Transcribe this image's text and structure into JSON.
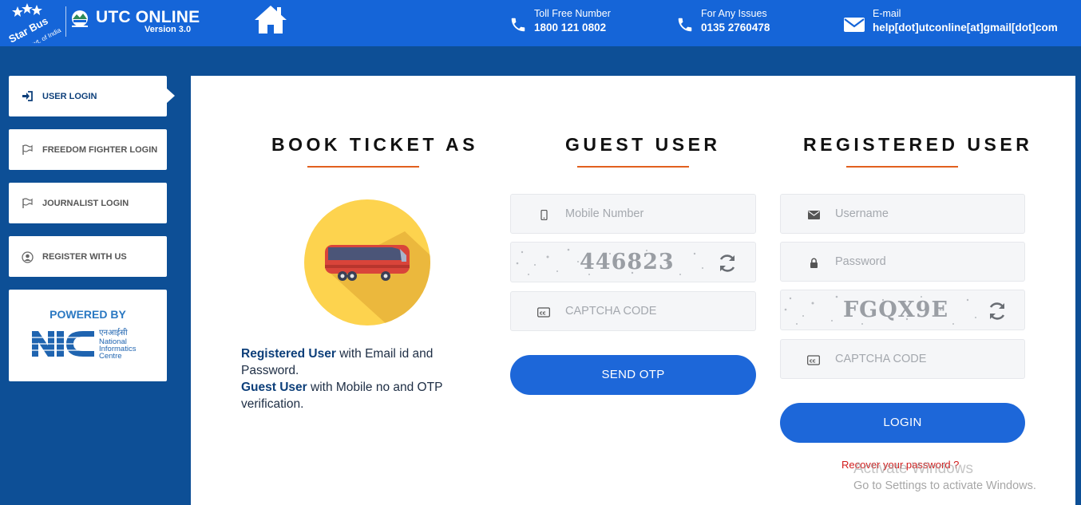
{
  "header": {
    "logo_text": "Star Bus",
    "logo_subtext": "Govt. of India",
    "app_title": "UTC ONLINE",
    "app_version": "Version 3.0",
    "home_icon": "home-icon",
    "contacts": [
      {
        "label": "Toll Free Number",
        "value": "1800 121 0802",
        "icon": "phone-icon"
      },
      {
        "label": "For Any Issues",
        "value": "0135 2760478",
        "icon": "phone-icon"
      },
      {
        "label": "E-mail",
        "value": "help[dot]utconline[at]gmail[dot]com",
        "icon": "envelope-icon"
      }
    ]
  },
  "sidebar": {
    "items": [
      {
        "label": "USER LOGIN",
        "icon": "sign-in-icon",
        "active": true
      },
      {
        "label": "FREEDOM FIGHTER LOGIN",
        "icon": "flag-icon"
      },
      {
        "label": "JOURNALIST LOGIN",
        "icon": "flag-icon"
      },
      {
        "label": "REGISTER WITH US",
        "icon": "user-circle-icon"
      }
    ],
    "powered_by": "POWERED BY",
    "nic": {
      "hindi": "एनआईसी",
      "line1": "National",
      "line2": "Informatics",
      "line3": "Centre"
    }
  },
  "book": {
    "title": "BOOK TICKET AS",
    "desc1_bold": "Registered User",
    "desc1_rest": " with Email id and Password.",
    "desc2_bold": "Guest User",
    "desc2_rest": " with Mobile no and OTP verification."
  },
  "guest": {
    "title": "GUEST USER",
    "mobile_placeholder": "Mobile Number",
    "captcha_image_text": "446823",
    "captcha_placeholder": "CAPTCHA CODE",
    "submit_label": "SEND OTP"
  },
  "registered": {
    "title": "REGISTERED USER",
    "username_placeholder": "Username",
    "password_placeholder": "Password",
    "captcha_image_text": "FGQX9E",
    "captcha_placeholder": "CAPTCHA CODE",
    "submit_label": "LOGIN",
    "recover_label": "Recover your password ?"
  },
  "watermark": {
    "line1": "Activate Windows",
    "line2": "Go to Settings to activate Windows."
  },
  "colors": {
    "header_bg": "#1565d8",
    "page_bg": "#0d4f96",
    "accent_line": "#e2601e",
    "button": "#1d67d9",
    "recover_text": "#d21d1d"
  }
}
